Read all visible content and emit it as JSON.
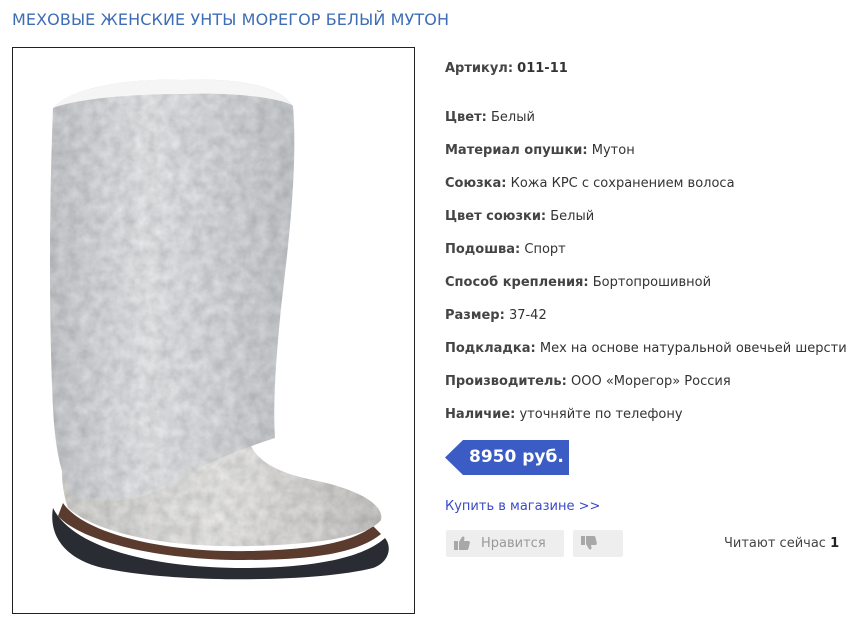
{
  "title": "МЕХОВЫЕ ЖЕНСКИЕ УНТЫ МОРЕГОР БЕЛЫЙ МУТОН",
  "product_image": {
    "alt": "white fur boot"
  },
  "specs": [
    {
      "label": "Артикул:",
      "value": "011-11"
    },
    {
      "label": "Цвет:",
      "value": "Белый"
    },
    {
      "label": "Материал опушки:",
      "value": "Мутон"
    },
    {
      "label": "Союзка:",
      "value": "Кожа КРС с сохранением волоса"
    },
    {
      "label": "Цвет союзки:",
      "value": "Белый"
    },
    {
      "label": "Подошва:",
      "value": "Спорт"
    },
    {
      "label": "Способ крепления:",
      "value": "Бортопрошивной"
    },
    {
      "label": "Размер:",
      "value": "37-42"
    },
    {
      "label": "Подкладка:",
      "value": "Мех на основе натуральной овечьей шерсти"
    },
    {
      "label": "Производитель:",
      "value": "ООО «Морегор» Россия"
    },
    {
      "label": "Наличие:",
      "value": "уточняйте по телефону"
    }
  ],
  "price": "8950 руб.",
  "buy_link": "Купить в магазине >>",
  "like_label": "Нравится",
  "readers": {
    "label": "Читают сейчас",
    "count": "1"
  },
  "icons": {
    "like": "thumbs-up-icon",
    "dislike": "thumbs-down-icon"
  },
  "colors": {
    "title": "#3d6db5",
    "price_bg": "#3b5cc4",
    "link": "#3a49c7"
  }
}
